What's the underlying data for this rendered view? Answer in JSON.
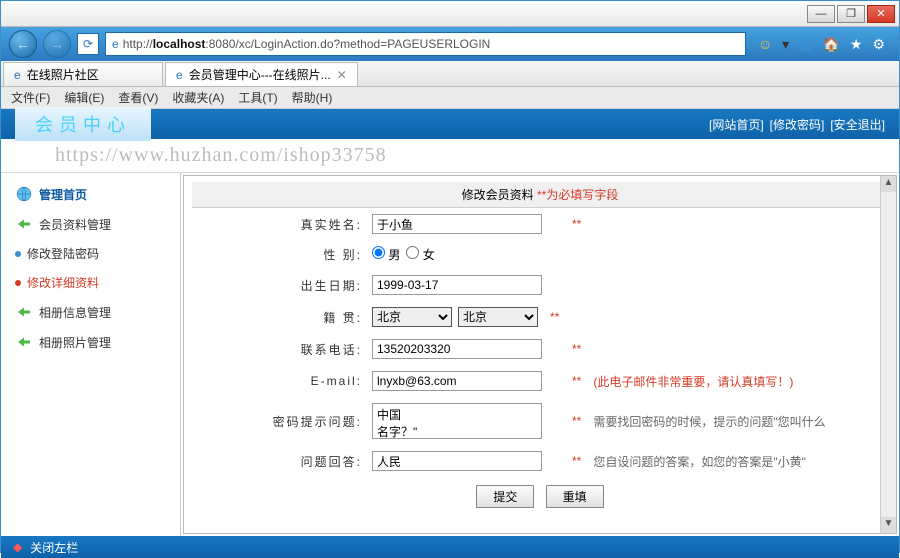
{
  "window": {
    "min": "—",
    "max": "❐",
    "close": "✕"
  },
  "url": {
    "scheme": "http://",
    "host": "localhost",
    "rest": ":8080/xc/LoginAction.do?method=PAGEUSERLOGIN"
  },
  "tabs": [
    {
      "label": "在线照片社区"
    },
    {
      "label": "会员管理中心---在线照片..."
    }
  ],
  "menu": {
    "file": "文件(F)",
    "edit": "编辑(E)",
    "view": "查看(V)",
    "fav": "收藏夹(A)",
    "tool": "工具(T)",
    "help": "帮助(H)"
  },
  "header": {
    "logo": "会员中心",
    "links": [
      "[网站首页]",
      "[修改密码]",
      "[安全退出]"
    ]
  },
  "watermark": "https://www.huzhan.com/ishop33758",
  "sidebar": {
    "head": "管理首页",
    "items": [
      {
        "label": "会员资料管理"
      },
      {
        "label": "修改登陆密码"
      },
      {
        "label": "修改详细资料",
        "active": true
      },
      {
        "label": "相册信息管理"
      },
      {
        "label": "相册照片管理"
      }
    ]
  },
  "form": {
    "title": "修改会员资料",
    "title_req": "**为必填写字段",
    "name_label": "真实姓名:",
    "name_value": "于小鱼",
    "gender_label": "性 别:",
    "gender_m": "男",
    "gender_f": "女",
    "birth_label": "出生日期:",
    "birth_value": "1999-03-17",
    "place_label": "籍 贯:",
    "place1": "北京",
    "place2": "北京",
    "phone_label": "联系电话:",
    "phone_value": "13520203320",
    "email_label": "E-mail:",
    "email_value": "lnyxb@63.com",
    "email_hint": "(此电子邮件非常重要，请认真填写！)",
    "q_label": "密码提示问题:",
    "q_value": "中国\n名字？\"",
    "q_hint": "需要找回密码的时候，提示的问题\"您叫什么",
    "a_label": "问题回答:",
    "a_value": "人民",
    "a_hint": "您自设问题的答案，如您的答案是\"小黄\"",
    "star": "**",
    "submit": "提交",
    "reset": "重填"
  },
  "footer": {
    "close": "关闭左栏"
  }
}
